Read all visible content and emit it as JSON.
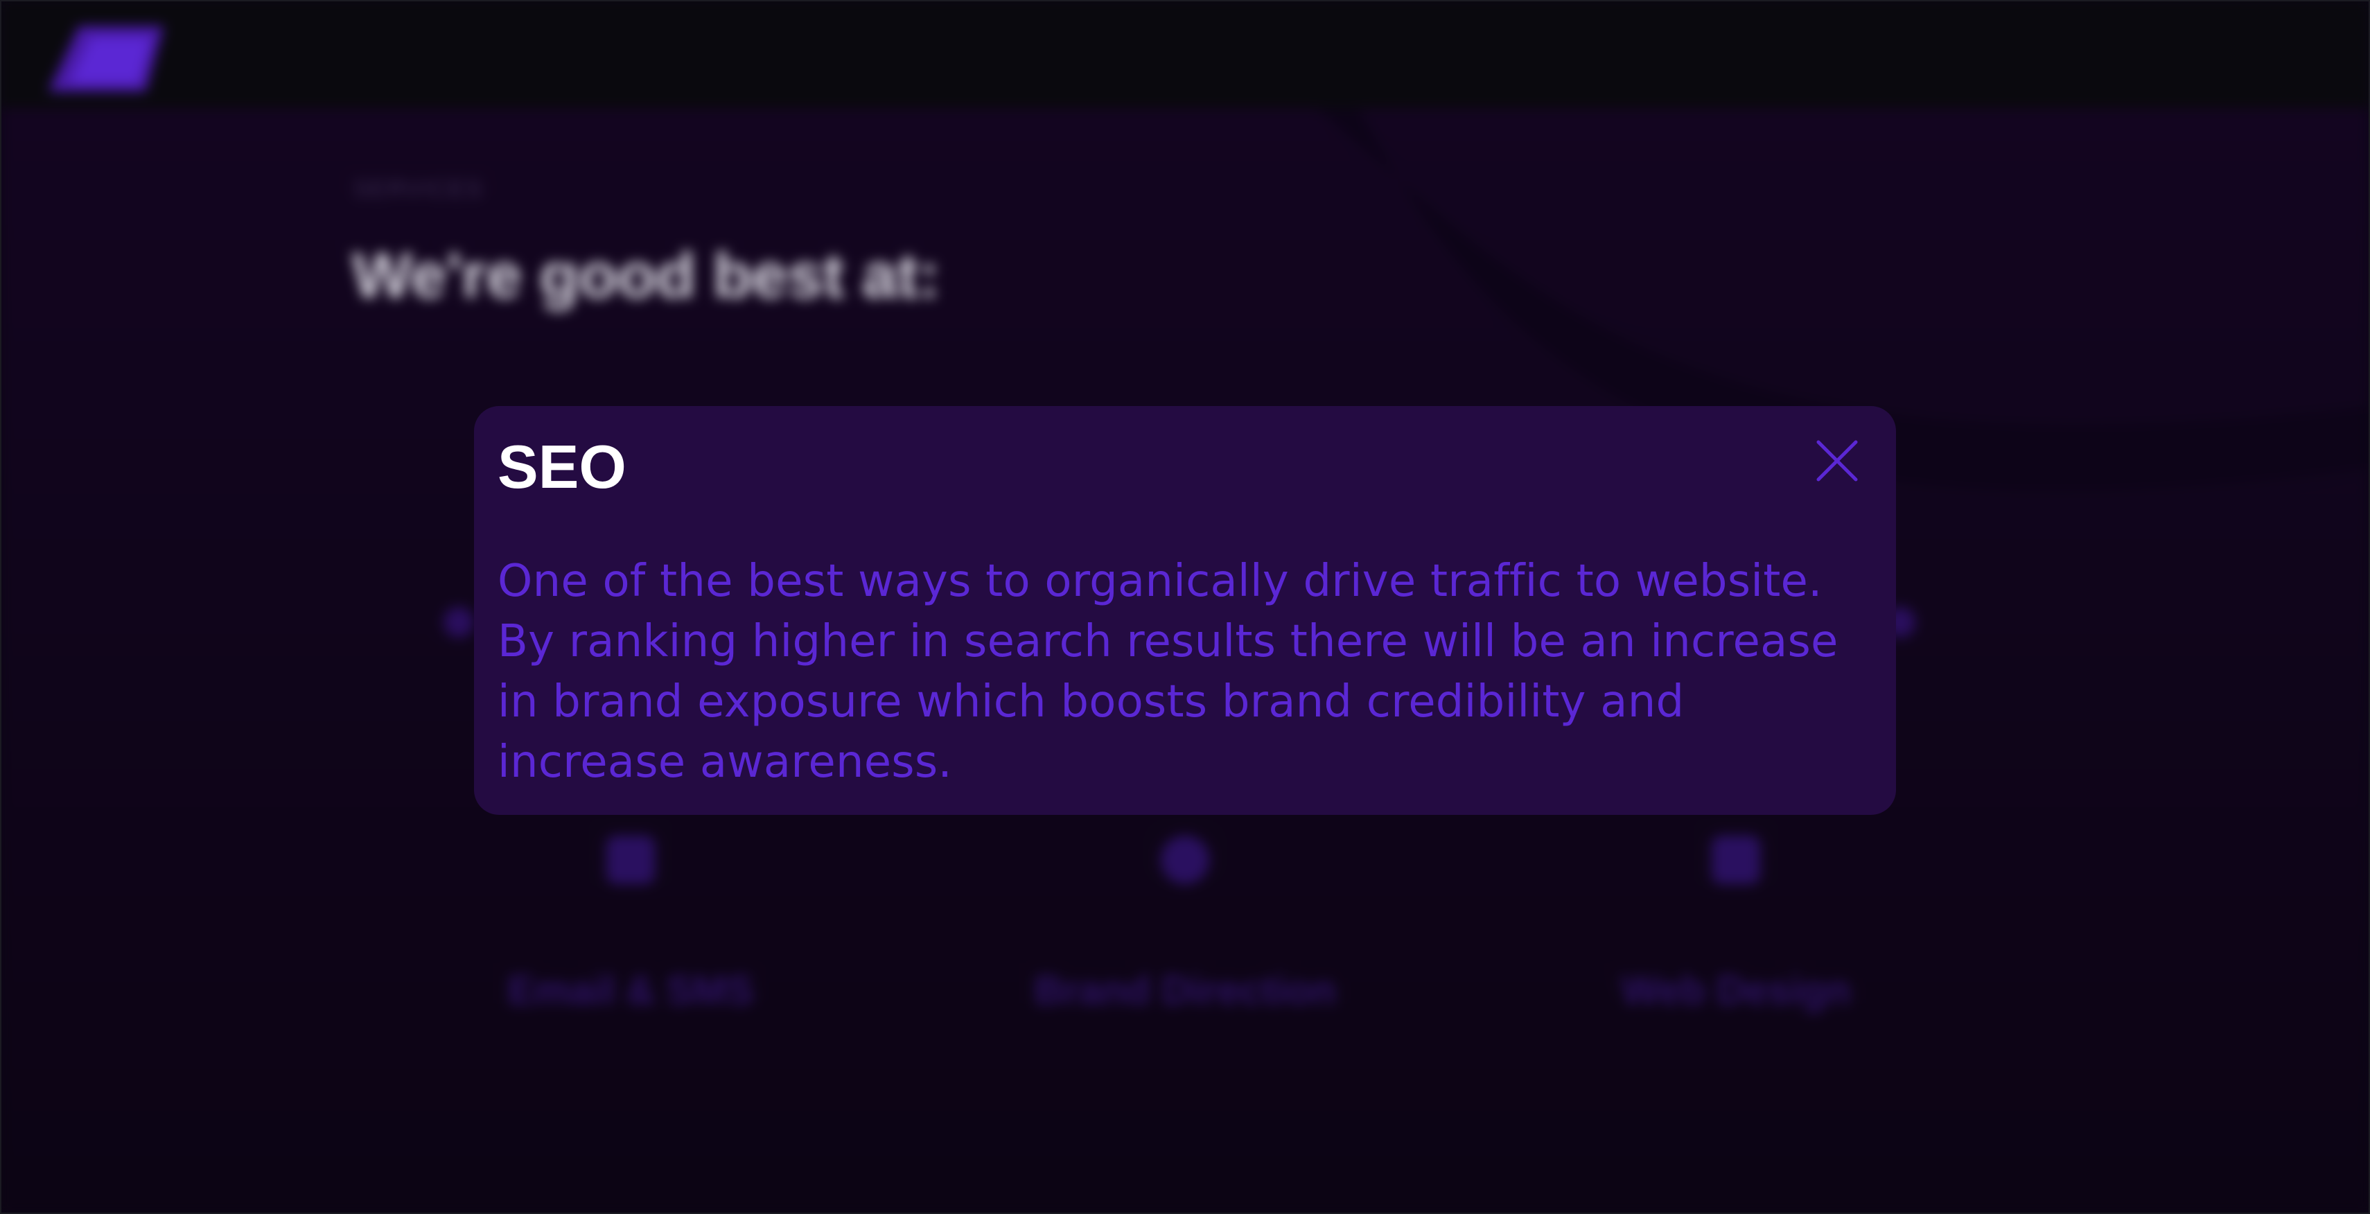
{
  "background": {
    "eyebrow": "SERVICES",
    "headline": "We're good best at:",
    "services": [
      {
        "label": "Email & SMS",
        "icon": "envelope-icon"
      },
      {
        "label": "Brand Direction",
        "icon": "compass-icon"
      },
      {
        "label": "Web Design",
        "icon": "monitor-icon"
      }
    ]
  },
  "modal": {
    "title": "SEO",
    "description": "One of the best ways to organically drive traffic to website. By ranking higher in search results there will be an increase in brand exposure which boosts brand credibility and increase awareness.",
    "close_icon": "close-icon"
  },
  "colors": {
    "accent": "#5b27d4",
    "modal_bg": "#240b42",
    "page_bg": "#10051b",
    "topbar_bg": "#0a090e"
  }
}
